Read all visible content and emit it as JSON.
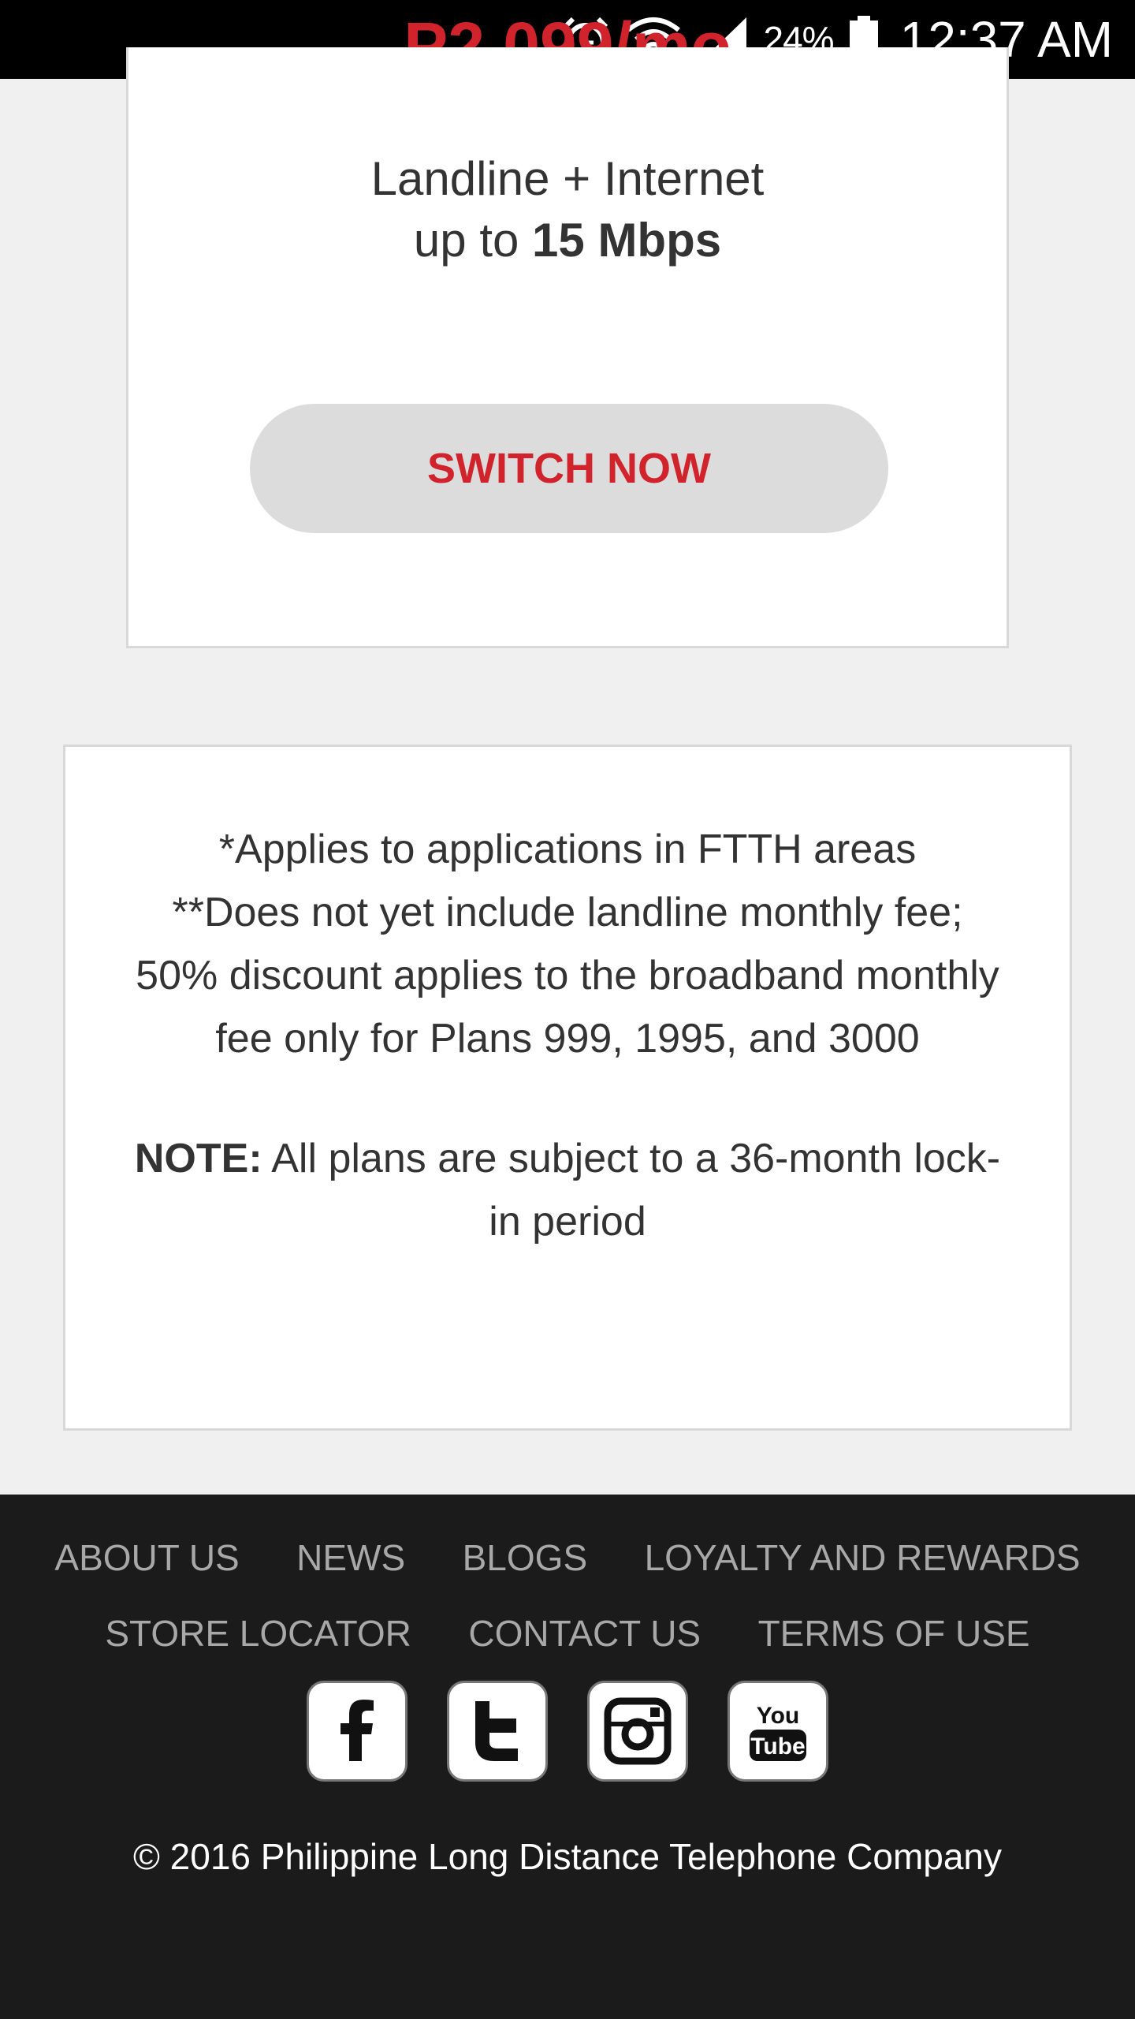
{
  "status_bar": {
    "battery_percent": "24%",
    "time": "12:37 AM",
    "icons": [
      "alarm-icon",
      "wifi-icon",
      "signal-icon",
      "battery-icon"
    ]
  },
  "plan": {
    "price_partial": "P2,099/mo",
    "line1": "Landline + Internet",
    "line2_prefix": "up to",
    "line2_speed": "15 Mbps",
    "button_label": "SWITCH NOW"
  },
  "notes": {
    "line1": "*Applies to applications in FTTH areas",
    "line2": "**Does not yet include landline monthly fee; 50% discount applies to the broadband monthly fee only for Plans 999, 1995, and 3000",
    "note_label": "NOTE:",
    "note_text": "All plans are subject to a 36-month lock-in period"
  },
  "footer": {
    "links": [
      "ABOUT US",
      "NEWS",
      "BLOGS",
      "LOYALTY AND REWARDS",
      "STORE LOCATOR",
      "CONTACT US",
      "TERMS OF USE"
    ],
    "social": [
      "facebook-icon",
      "twitter-icon",
      "instagram-icon",
      "youtube-icon"
    ],
    "copyright": "© 2016 Philippine Long Distance Telephone Company"
  },
  "colors": {
    "accent": "#d0232b",
    "footer_bg": "#1b1b1b",
    "page_bg": "#f0f0f0"
  }
}
